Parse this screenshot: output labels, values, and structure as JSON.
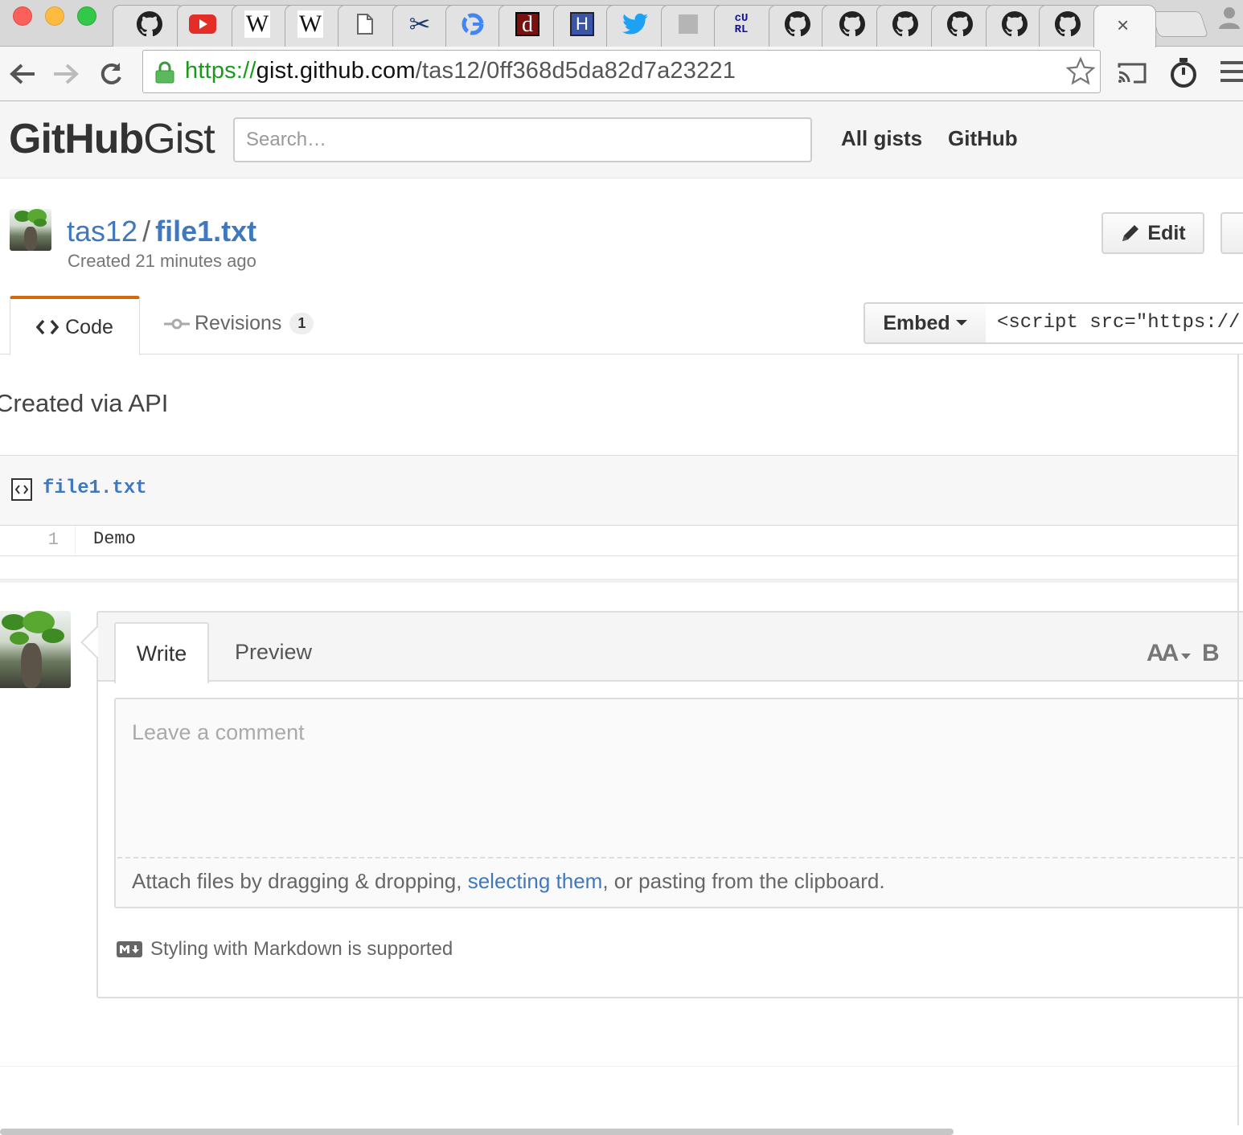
{
  "browser": {
    "tab_favicons": [
      "github-icon",
      "youtube-icon",
      "wikipedia-icon",
      "wikipedia-icon",
      "document-icon",
      "xmind-icon",
      "google-icon",
      "d-icon",
      "h-icon",
      "twitter-icon",
      "grey-square-icon",
      "curl-icon",
      "github-icon",
      "github-icon",
      "github-icon",
      "github-icon",
      "github-icon",
      "github-icon"
    ],
    "active_tab_close": "×",
    "url": {
      "scheme": "https://",
      "host": "gist.github.com",
      "path": "/tas12/0ff368d5da82d7a23221"
    }
  },
  "header": {
    "logo_bold": "GitHub",
    "logo_light": "Gist",
    "search_placeholder": "Search…",
    "links": [
      "All gists",
      "GitHub"
    ]
  },
  "gist": {
    "owner": "tas12",
    "separator": "/",
    "filename": "file1.txt",
    "created": "Created 21 minutes ago",
    "edit_label": "Edit",
    "tabs": {
      "code": "Code",
      "revisions": "Revisions",
      "revisions_count": "1"
    },
    "embed_label": "Embed",
    "embed_value": "<script src=\"https://",
    "description": "Created via API",
    "file": {
      "name": "file1.txt",
      "lines": [
        {
          "number": "1",
          "code": "Demo"
        }
      ]
    }
  },
  "comment": {
    "tab_write": "Write",
    "tab_preview": "Preview",
    "text_size_label": "AA",
    "bold_label": "B",
    "placeholder": "Leave a comment",
    "attach_prefix": "Attach files by dragging & dropping, ",
    "attach_link": "selecting them",
    "attach_suffix": ", or pasting from the clipboard.",
    "markdown_badge": "M↓",
    "markdown_note": "Styling with Markdown is supported"
  },
  "colors": {
    "link": "#4078c0",
    "tab_accent": "#d26911",
    "secure_green": "#1a9a1a"
  }
}
